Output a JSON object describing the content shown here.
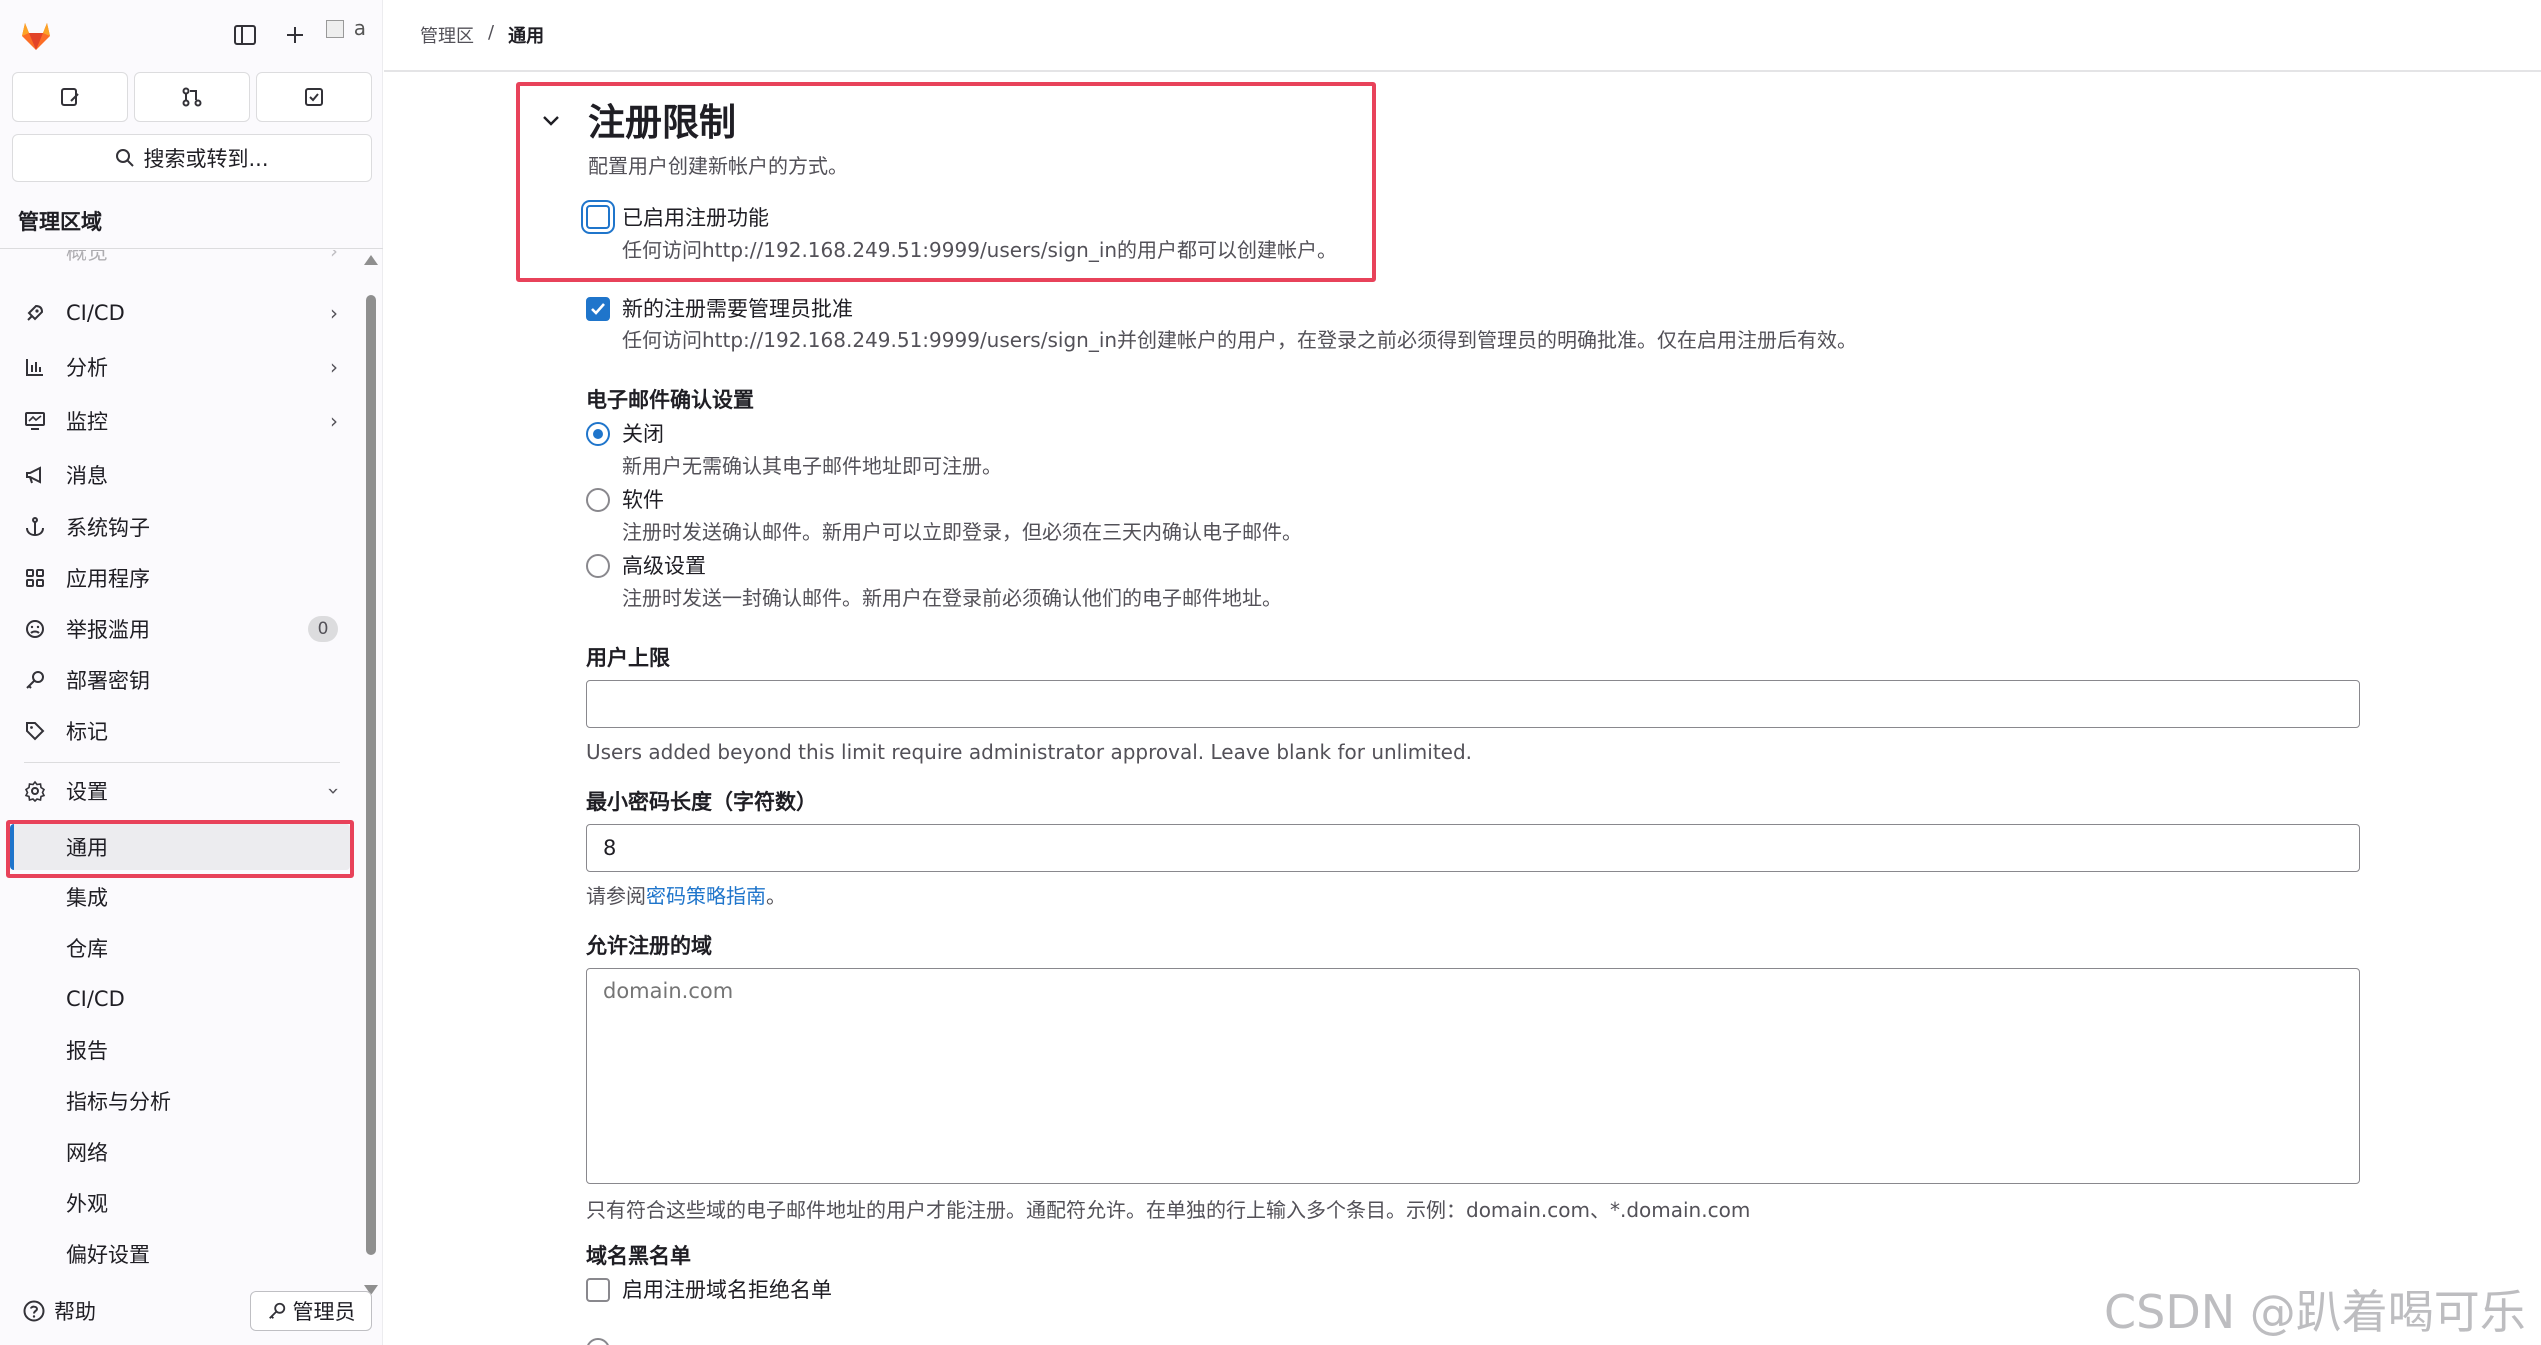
{
  "sidebar": {
    "quick_actions": [
      "issues-icon",
      "merge-requests-icon",
      "todo-icon"
    ],
    "search_label": "搜索或转到...",
    "section_title": "管理区域",
    "items": [
      {
        "label": "概览",
        "icon": "grid-icon"
      },
      {
        "label": "CI/CD",
        "icon": "rocket-icon"
      },
      {
        "label": "分析",
        "icon": "chart-icon"
      },
      {
        "label": "监控",
        "icon": "monitor-icon"
      },
      {
        "label": "消息",
        "icon": "megaphone-icon"
      },
      {
        "label": "系统钩子",
        "icon": "anchor-icon"
      },
      {
        "label": "应用程序",
        "icon": "apps-icon"
      },
      {
        "label": "举报滥用",
        "icon": "abuse-icon",
        "badge": "0"
      },
      {
        "label": "部署密钥",
        "icon": "key-icon"
      },
      {
        "label": "标记",
        "icon": "label-icon"
      },
      {
        "label": "设置",
        "icon": "gear-icon"
      }
    ],
    "settings_sub": [
      "通用",
      "集成",
      "仓库",
      "CI/CD",
      "报告",
      "指标与分析",
      "网络",
      "外观",
      "偏好设置"
    ],
    "help_label": "帮助",
    "admin_label": "管理员"
  },
  "breadcrumb": {
    "parent": "管理区",
    "separator": "/",
    "current": "通用"
  },
  "signup": {
    "title": "注册限制",
    "description": "配置用户创建新帐户的方式。",
    "enabled": {
      "label": "已启用注册功能",
      "checked": false,
      "help": "任何访问http://192.168.249.51:9999/users/sign_in的用户都可以创建帐户。"
    },
    "approval": {
      "label": "新的注册需要管理员批准",
      "checked": true,
      "help": "任何访问http://192.168.249.51:9999/users/sign_in并创建帐户的用户，在登录之前必须得到管理员的明确批准。仅在启用注册后有效。"
    },
    "email_confirm": {
      "label": "电子邮件确认设置",
      "options": [
        {
          "label": "关闭",
          "help": "新用户无需确认其电子邮件地址即可注册。",
          "checked": true
        },
        {
          "label": "软件",
          "help": "注册时发送确认邮件。新用户可以立即登录，但必须在三天内确认电子邮件。",
          "checked": false
        },
        {
          "label": "高级设置",
          "help": "注册时发送一封确认邮件。新用户在登录前必须确认他们的电子邮件地址。",
          "checked": false
        }
      ]
    },
    "user_cap": {
      "label": "用户上限",
      "value": "",
      "help": "Users added beyond this limit require administrator approval. Leave blank for unlimited."
    },
    "min_password": {
      "label": "最小密码长度（字符数）",
      "value": "8",
      "help_prefix": "请参阅",
      "help_link": "密码策略指南",
      "help_suffix": "。"
    },
    "allowed_domains": {
      "label": "允许注册的域",
      "placeholder": "domain.com",
      "help": "只有符合这些域的电子邮件地址的用户才能注册。通配符允许。在单独的行上输入多个条目。示例：domain.com、*.domain.com"
    },
    "denylist": {
      "label": "域名黑名单",
      "checkbox_label": "启用注册域名拒绝名单",
      "checked": false
    }
  },
  "watermark": "CSDN @趴着喝可乐",
  "colors": {
    "accent": "#1f75cb",
    "highlight": "#e8425a",
    "logo": "#e24329"
  }
}
